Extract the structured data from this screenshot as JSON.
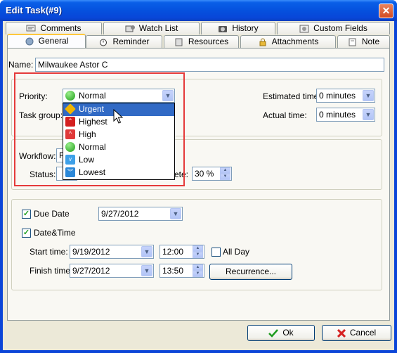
{
  "window": {
    "title": "Edit Task(#9)",
    "close_glyph": "✕"
  },
  "tabs_top": [
    {
      "label": "Comments",
      "icon": "comments-icon"
    },
    {
      "label": "Watch List",
      "icon": "watch-list-icon"
    },
    {
      "label": "History",
      "icon": "history-icon"
    },
    {
      "label": "Custom Fields",
      "icon": "custom-fields-icon"
    }
  ],
  "tabs_bottom": [
    {
      "label": "General",
      "icon": "general-icon",
      "active": true
    },
    {
      "label": "Reminder",
      "icon": "alarm-clock-icon"
    },
    {
      "label": "Resources",
      "icon": "resources-icon"
    },
    {
      "label": "Attachments",
      "icon": "lock-icon"
    },
    {
      "label": "Note",
      "icon": "note-icon"
    }
  ],
  "name": {
    "label": "Name:",
    "value": "Milwaukee Astor C"
  },
  "priority": {
    "label": "Priority:",
    "value": "Normal",
    "options": [
      "Urgent",
      "Highest",
      "High",
      "Normal",
      "Low",
      "Lowest"
    ],
    "highlighted": "Urgent"
  },
  "task_group": {
    "label": "Task group:"
  },
  "estimated_time": {
    "label": "Estimated time:",
    "value": "0 minutes"
  },
  "actual_time": {
    "label": "Actual time:",
    "value": "0 minutes"
  },
  "workflow": {
    "label": "Workflow:",
    "value": "F"
  },
  "status": {
    "label": "Status:"
  },
  "complete": {
    "label_fragment": "ete:",
    "value": "30 %"
  },
  "due_date": {
    "label": "Due Date",
    "checked": true,
    "value": "9/27/2012"
  },
  "date_time": {
    "label": "Date&Time",
    "checked": true
  },
  "start_time": {
    "label": "Start time:",
    "date": "9/19/2012",
    "time": "12:00"
  },
  "all_day": {
    "label": "All Day",
    "checked": false
  },
  "finish_time": {
    "label": "Finish time:",
    "date": "9/27/2012",
    "time": "13:50"
  },
  "recurrence_button": "Recurrence...",
  "ok_button": "Ok",
  "cancel_button": "Cancel",
  "colors": {
    "titlebar": "#0551de",
    "highlight": "#316ac5",
    "annotation": "#e53a3a",
    "face": "#ece9d8"
  }
}
